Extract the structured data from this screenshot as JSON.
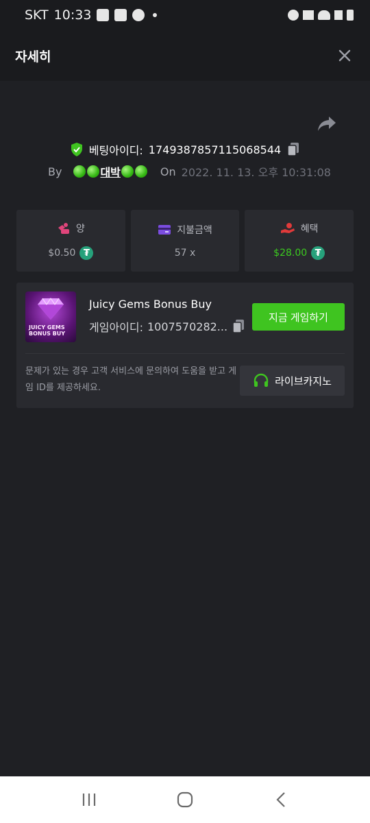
{
  "status_bar": {
    "carrier": "SKT",
    "time": "10:33"
  },
  "header": {
    "title": "자세히"
  },
  "bet": {
    "id_label": "베팅아이디:",
    "id_value": "1749387857115068544",
    "by_label": "By",
    "username": "대박",
    "on_label": "On",
    "date": "2022. 11. 13. 오후 10:31:08"
  },
  "stats": [
    {
      "label": "양",
      "value": "$0.50",
      "currency_icon": "tether-icon",
      "color": "#e0457b"
    },
    {
      "label": "지불금액",
      "value": "57 x",
      "color": "#7b4de0"
    },
    {
      "label": "혜택",
      "value": "$28.00",
      "currency_icon": "tether-icon",
      "color": "#e03a3a",
      "value_color": "#3ccb1f"
    }
  ],
  "game": {
    "name": "Juicy Gems Bonus Buy",
    "thumb_text_1": "JUICY GEMS",
    "thumb_text_2": "BONUS BUY",
    "id_label": "게임아이디:",
    "id_value": "1007570282...",
    "play_label": "지금 게임하기",
    "help_text": "문제가 있는 경우 고객 서비스에 문의하여 도움을 받고 게임 ID를 제공하세요.",
    "live_label": "라이브카지노"
  },
  "colors": {
    "accent_green": "#3fc420",
    "background": "#1f2024",
    "card": "#292a2f"
  }
}
